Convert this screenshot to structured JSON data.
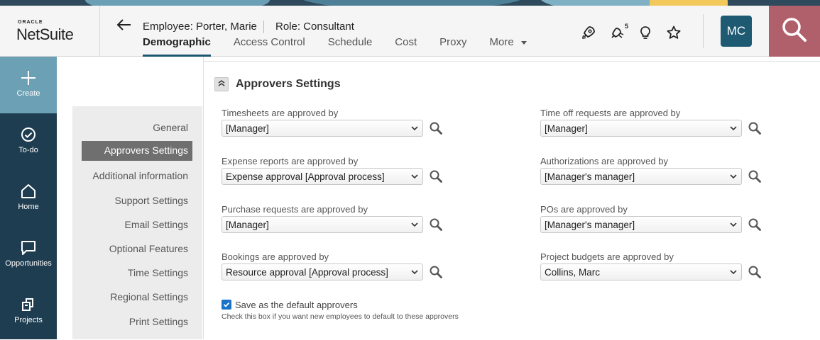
{
  "header": {
    "logo_top": "ORACLE",
    "logo_main": "NetSuite",
    "employee": "Employee: Porter, Marie",
    "role": "Role: Consultant",
    "tabs": [
      "Demographic",
      "Access Control",
      "Schedule",
      "Cost",
      "Proxy",
      "More"
    ],
    "active_tab": "Demographic",
    "icons": [
      "rocket-icon",
      "recent-records-icon",
      "lightbulb-icon",
      "star-icon"
    ],
    "recent_badge": "5",
    "avatar_initials": "MC",
    "search_icon": "search-icon"
  },
  "leftnav": {
    "items": [
      {
        "label": "Create",
        "icon": "plus-icon"
      },
      {
        "label": "To-do",
        "icon": "check-circle-icon"
      },
      {
        "label": "Home",
        "icon": "home-icon"
      },
      {
        "label": "Opportunities",
        "icon": "chat-icon"
      },
      {
        "label": "Projects",
        "icon": "projects-icon"
      }
    ]
  },
  "subnav": {
    "items": [
      "General",
      "Approvers Settings",
      "Additional information",
      "Support Settings",
      "Email Settings",
      "Optional Features",
      "Time Settings",
      "Regional Settings",
      "Print Settings"
    ],
    "active": "Approvers Settings"
  },
  "section": {
    "title": "Approvers Settings",
    "fields": [
      {
        "label": "Timesheets are approved by",
        "value": "[Manager]"
      },
      {
        "label": "Time off requests are approved by",
        "value": "[Manager]"
      },
      {
        "label": "Expense reports are approved by",
        "value": "Expense approval [Approval process]"
      },
      {
        "label": "Authorizations are approved by",
        "value": "[Manager's manager]"
      },
      {
        "label": "Purchase requests are approved by",
        "value": "[Manager]"
      },
      {
        "label": "POs are approved by",
        "value": "[Manager's manager]"
      },
      {
        "label": "Bookings are approved by",
        "value": "Resource approval [Approval process]"
      },
      {
        "label": "Project budgets are approved by",
        "value": "Collins, Marc"
      }
    ],
    "default_checkbox": {
      "label": "Save as the default approvers",
      "checked": true,
      "help": "Check this box if you want new employees to default to these approvers"
    }
  },
  "colors": {
    "nav_bg": "#1f3d50",
    "create_bg": "#6ca0b5",
    "search_bg": "#b0606b",
    "avatar_bg": "#1f5a73",
    "checkbox": "#1a73c9"
  }
}
